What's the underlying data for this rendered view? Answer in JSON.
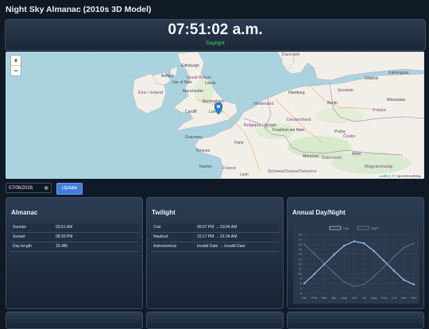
{
  "app": {
    "title": "Night Sky Almanac (2010s 3D Model)"
  },
  "clock": {
    "time": "07:51:02 a.m.",
    "status": "Daylight",
    "status_color": "#44d46b"
  },
  "map": {
    "zoom_in": "+",
    "zoom_out": "−",
    "attribution_leaflet": "Leaflet",
    "attribution_rest": "| © OpenStreetMap",
    "labels": {
      "edinburgh": "Edinburgh",
      "belfast": "Belfast",
      "isle_of_man": "Isle of Man",
      "great_britain": "Great Britain",
      "leeds": "Leeds",
      "eire": "Éire / Ireland",
      "manchester": "Manchester",
      "birmingham": "Birmingham",
      "cardiff": "Cardiff",
      "london": "London",
      "guernsey": "Guernsey",
      "rennes": "Rennes",
      "nantes": "Nantes",
      "france": "France",
      "paris": "Paris",
      "belgique": "Belgique / België",
      "nederland": "Nederland",
      "deutschland": "Deutschland",
      "danmark": "Danmark",
      "hamburg": "Hamburg",
      "berlin": "Berlin",
      "polska": "Polska",
      "cesko": "Česko",
      "osterreich": "Österreich",
      "schweiz": "Schweiz/Suisse/Svizzera",
      "magyarorszag": "Magyarország",
      "frankfurt": "Frankfurt am Main",
      "munchen": "München",
      "praha": "Praha",
      "wien": "Wien",
      "warszawa": "Warszawa",
      "szczecin": "Szczecin",
      "gdansk": "Gdańsk",
      "kaliningrad": "Kaliningrad",
      "lyon": "Lyon"
    }
  },
  "controls": {
    "date_value": "07/06/2026",
    "update_label": "Update"
  },
  "almanac": {
    "title": "Almanac",
    "rows": [
      {
        "label": "Sunrise",
        "value": "03:51 AM"
      },
      {
        "label": "Sunset",
        "value": "08:20 PM"
      },
      {
        "label": "Day length",
        "value": "16.48h"
      }
    ]
  },
  "twilight": {
    "title": "Twilight",
    "rows": [
      {
        "label": "Civil",
        "value": "09:07 PM → 03:04 AM"
      },
      {
        "label": "Nautical",
        "value": "10:17 PM → 01:34 AM"
      },
      {
        "label": "Astronomical",
        "value": "Invalid Date → Invalid Date"
      }
    ]
  },
  "annual": {
    "title": "Annual Day/Night"
  },
  "chart_data": {
    "type": "line",
    "categories": [
      "Jan",
      "Feb",
      "Mar",
      "Apr",
      "May",
      "Jun",
      "Jul",
      "Aug",
      "Sep",
      "Oct",
      "Nov",
      "Dec"
    ],
    "series": [
      {
        "name": "Day",
        "color": "#9ec3f5",
        "values": [
          8.0,
          9.9,
          11.9,
          13.9,
          15.7,
          16.6,
          16.2,
          14.6,
          12.6,
          10.6,
          8.7,
          7.8
        ]
      },
      {
        "name": "Night",
        "color": "#6b7c8f",
        "values": [
          16.0,
          14.1,
          12.1,
          10.1,
          8.3,
          7.4,
          7.8,
          9.4,
          11.4,
          13.4,
          15.3,
          16.2
        ]
      }
    ],
    "yticks": [
      "6",
      "7",
      "8",
      "9",
      "10",
      "11",
      "12",
      "13",
      "14",
      "15",
      "16",
      "17",
      "18"
    ],
    "ylim": [
      6,
      18
    ],
    "legend": "top-center"
  }
}
